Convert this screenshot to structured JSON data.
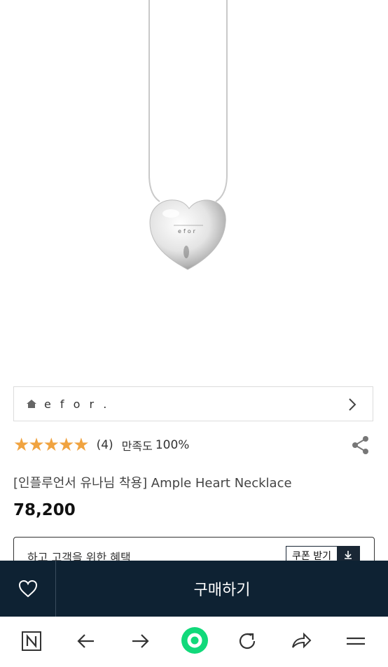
{
  "product": {
    "image_alt_icon": "heart-pendant-necklace",
    "pendant_engraving": "efor"
  },
  "brand": {
    "name": "e f o r ."
  },
  "rating": {
    "stars": 5,
    "review_count": "(4)",
    "satisfaction_label": "만족도",
    "satisfaction_value": "100%"
  },
  "title": "[인플루언서 유나님 착용] Ample Heart Necklace",
  "price": "78,200",
  "benefit": {
    "text": "하고 고객을 위한 혜택",
    "coupon_label": "쿠폰 받기"
  },
  "buy_bar": {
    "buy_label": "구매하기"
  },
  "browser_nav": {
    "icons": [
      "naver-n-icon",
      "back-arrow-icon",
      "forward-arrow-icon",
      "green-home-icon",
      "reload-icon",
      "share-arrow-icon",
      "menu-icon"
    ]
  },
  "colors": {
    "star": "#f0a340",
    "buy_bar_bg": "#0e2233",
    "green_dot": "#11d97a"
  }
}
